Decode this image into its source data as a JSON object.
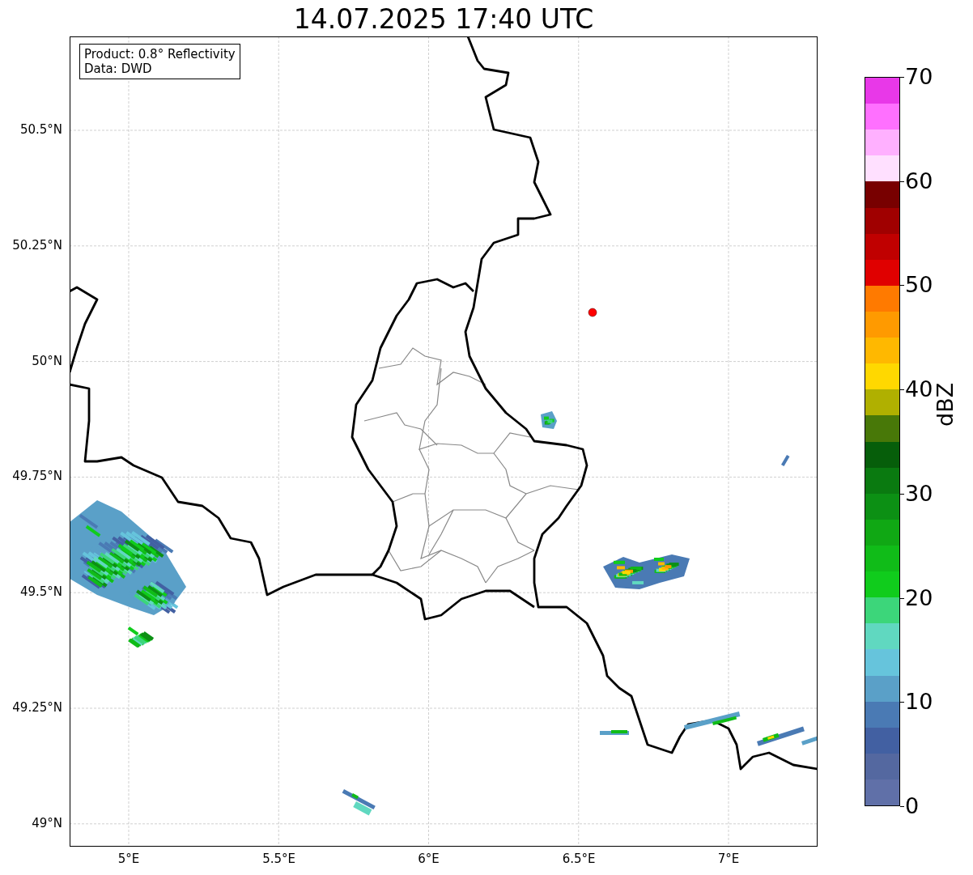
{
  "title": "14.07.2025 17:40 UTC",
  "map": {
    "info_box": [
      "Product: 0.8° Reflectivity",
      "Data: DWD"
    ],
    "x_ticks": [
      "5°E",
      "5.5°E",
      "6°E",
      "6.5°E",
      "7°E"
    ],
    "y_ticks": [
      "50.5°N",
      "50.25°N",
      "50°N",
      "49.75°N",
      "49.5°N",
      "49.25°N",
      "49°N"
    ]
  },
  "colorbar": {
    "label": "dBZ",
    "ticks": [
      "70",
      "60",
      "50",
      "40",
      "30",
      "20",
      "10",
      "0"
    ],
    "segments": [
      {
        "color": "#e838e8"
      },
      {
        "color": "#ff70ff"
      },
      {
        "color": "#ffb0ff"
      },
      {
        "color": "#ffe0ff"
      },
      {
        "color": "#780000"
      },
      {
        "color": "#a00000"
      },
      {
        "color": "#c00000"
      },
      {
        "color": "#e00000"
      },
      {
        "color": "#ff7a00"
      },
      {
        "color": "#ff9a00"
      },
      {
        "color": "#ffb800"
      },
      {
        "color": "#ffd800"
      },
      {
        "color": "#b0b000"
      },
      {
        "color": "#487808"
      },
      {
        "color": "#065e0a"
      },
      {
        "color": "#0a7a10"
      },
      {
        "color": "#0c9014"
      },
      {
        "color": "#10a814"
      },
      {
        "color": "#10bc18"
      },
      {
        "color": "#10cc1c"
      },
      {
        "color": "#3cd67a"
      },
      {
        "color": "#60d8c0"
      },
      {
        "color": "#66c4dc"
      },
      {
        "color": "#5aa0c8"
      },
      {
        "color": "#4a7ab4"
      },
      {
        "color": "#4260a2"
      },
      {
        "color": "#5468a0"
      },
      {
        "color": "#6070a8"
      }
    ]
  }
}
